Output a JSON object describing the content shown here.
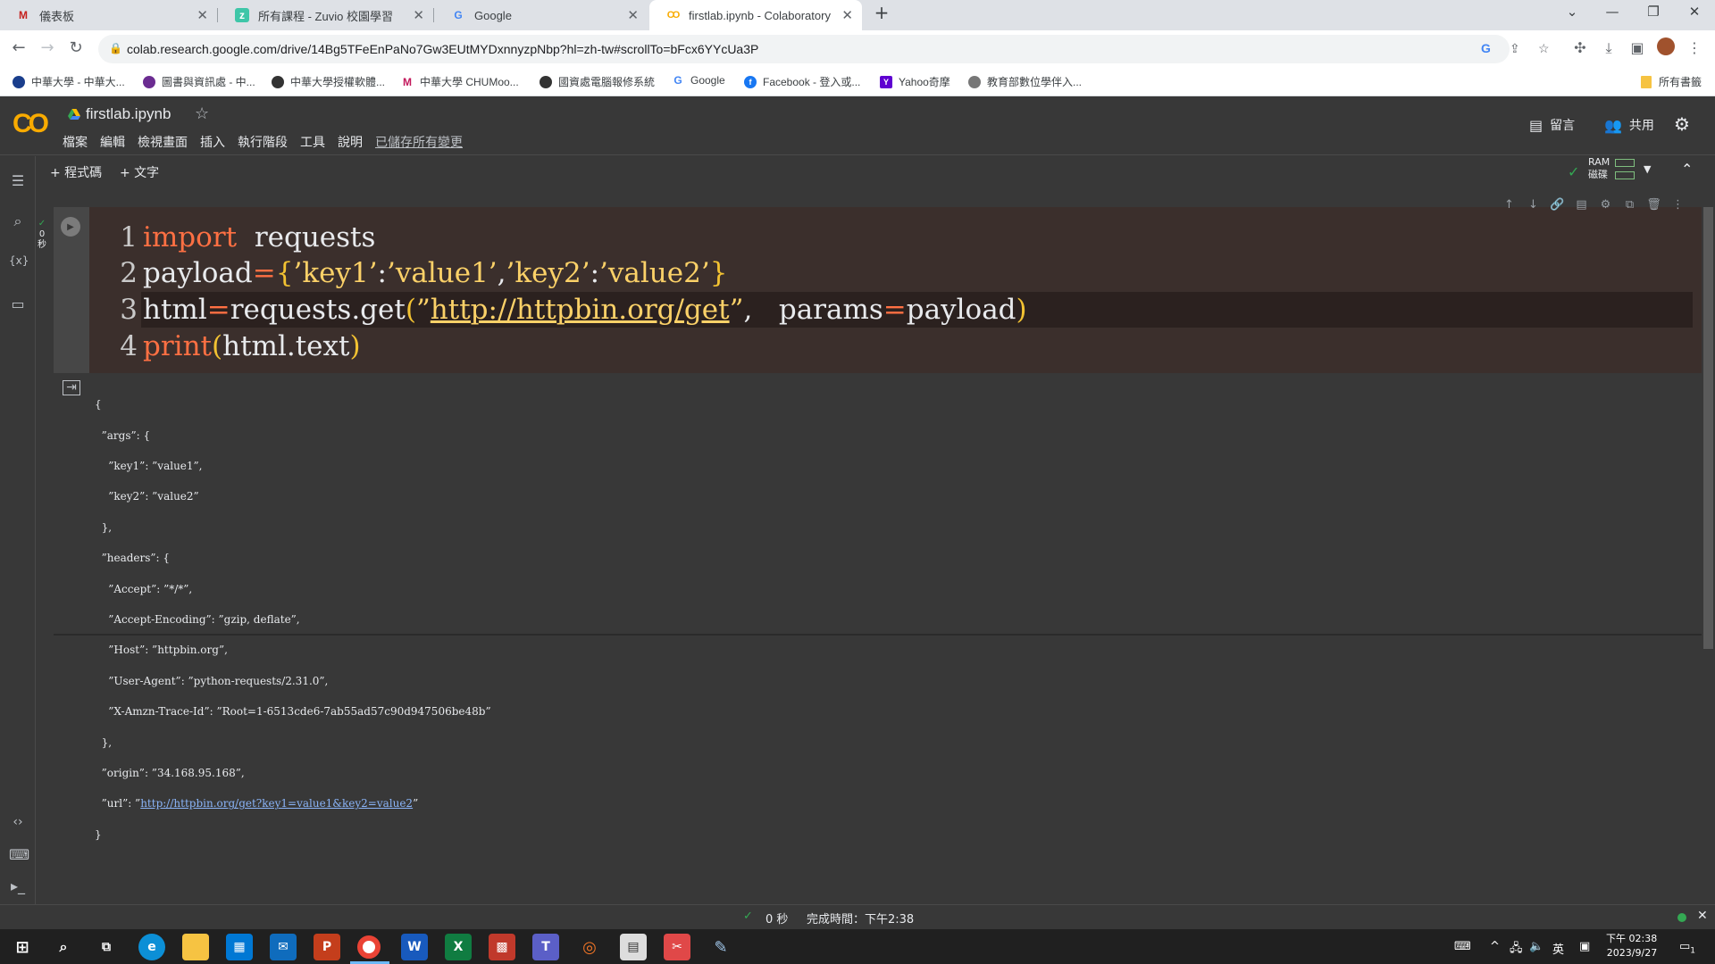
{
  "browser": {
    "tabs": [
      {
        "title": "儀表板",
        "favicon": "gmail-icon"
      },
      {
        "title": "所有課程 - Zuvio 校園學習",
        "favicon": "zuvio-icon"
      },
      {
        "title": "Google",
        "favicon": "google-icon"
      },
      {
        "title": "firstlab.ipynb - Colaboratory",
        "favicon": "colab-icon",
        "active": true
      }
    ],
    "new_tab": "+",
    "url": "colab.research.google.com/drive/14Bg5TFeEnPaNo7Gw3EUtMYDxnnyzpNbp?hl=zh-tw#scrollTo=bFcx6YYcUa3P",
    "bookmarks": [
      {
        "label": "中華大學 - 中華大...",
        "color": "#1a3e8c"
      },
      {
        "label": "圖書與資訊處 - 中...",
        "color": "#6b2c91"
      },
      {
        "label": "中華大學授權軟體...",
        "color": "#333333"
      },
      {
        "label": "中華大學 CHUMoo...",
        "color": "#c2185b"
      },
      {
        "label": "國資處電腦報修系統",
        "color": "#333333"
      },
      {
        "label": "Google",
        "color": "#4285f4"
      },
      {
        "label": "Facebook - 登入或...",
        "color": "#1877f2"
      },
      {
        "label": "Yahoo奇摩",
        "color": "#5f01d1"
      },
      {
        "label": "教育部數位學伴入...",
        "color": "#777777"
      }
    ],
    "all_bookmarks": "所有書籤"
  },
  "colab": {
    "logo": "CO",
    "notebook_name": "firstlab.ipynb",
    "menu": [
      "檔案",
      "編輯",
      "檢視畫面",
      "插入",
      "執行階段",
      "工具",
      "說明"
    ],
    "saved_status": "已儲存所有變更",
    "comment_label": "留言",
    "share_label": "共用",
    "add_code": "+ 程式碼",
    "add_text": "+ 文字",
    "ram_label": "RAM",
    "disk_label": "磁碟",
    "exec_time_top": "0",
    "exec_time_unit": "秒"
  },
  "code": {
    "line_numbers": [
      "1",
      "2",
      "3",
      "4"
    ],
    "l1_kw": "import",
    "l1_rest": "  requests",
    "l2_a": "payload",
    "l2_eq": "=",
    "l2_open": "{",
    "l2_s1": "’key1’",
    "l2_c1": ":",
    "l2_s2": "’value1’",
    "l2_comma": ",",
    "l2_s3": "’key2’",
    "l2_c2": ":",
    "l2_s4": "’value2’",
    "l2_close": "}",
    "l3_a": "html",
    "l3_eq": "=",
    "l3_b": "requests.get",
    "l3_open": "(",
    "l3_q1": "”",
    "l3_url": "http://httpbin.org/get",
    "l3_q2": "”",
    "l3_c": ",   params",
    "l3_eq2": "=",
    "l3_d": "payload",
    "l3_close": ")",
    "l4_kw": "print",
    "l4_open": "(",
    "l4_arg": "html.text",
    "l4_close": ")"
  },
  "output": {
    "lines": [
      "{",
      "  ”args”: {",
      "    ”key1”: ”value1”,",
      "    ”key2”: ”value2”",
      "  },",
      "  ”headers”: {",
      "    ”Accept”: ”*/*”,",
      "    ”Accept-Encoding”: ”gzip, deflate”,",
      "    ”Host”: ”httpbin.org”,",
      "    ”User-Agent”: ”python-requests/2.31.0”,",
      "    ”X-Amzn-Trace-Id”: ”Root=1-6513cde6-7ab55ad57c90d947506be48b”",
      "  },",
      "  ”origin”: ”34.168.95.168”,"
    ],
    "url_prefix": "  ”url”: ”",
    "url_link": "http://httpbin.org/get?key1=value1&key2=value2",
    "url_suffix": "”",
    "closing": "}"
  },
  "status": {
    "check": "✓",
    "elapsed": "0 秒",
    "completed": "完成時間：下午2:38"
  },
  "taskbar": {
    "time": "下午 02:38",
    "date": "2023/9/27",
    "ime": "英",
    "notification_count": "1"
  }
}
